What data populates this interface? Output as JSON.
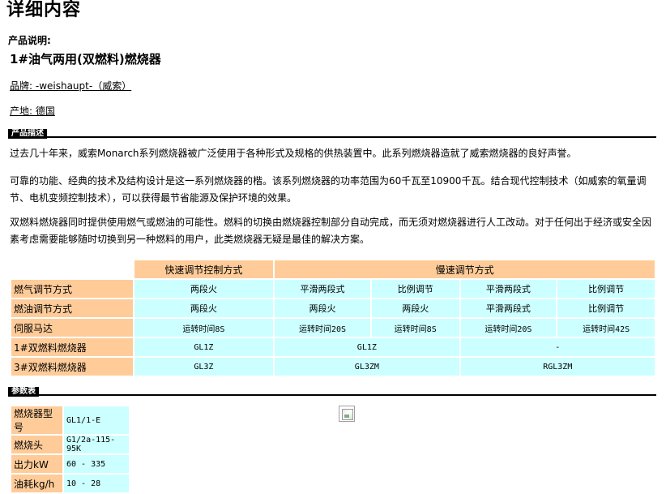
{
  "page": {
    "title": "详细内容",
    "desc_label": "产品说明:",
    "product_name": "1#油气两用(双燃料)燃烧器",
    "brand": "品牌: -weishaupt-（威索）",
    "origin": "产地: 德国"
  },
  "sections": {
    "intro_tag": "产品描述",
    "params_tag": "参数表"
  },
  "paragraphs": [
    "过去几十年来，威索Monarch系列燃烧器被广泛使用于各种形式及规格的供热装置中。此系列燃烧器造就了威索燃烧器的良好声誉。",
    "可靠的功能、经典的技术及结构设计是这一系列燃烧器的楷。该系列燃烧器的功率范围为60千瓦至10900千瓦。结合现代控制技术（如威索的氧量调节、电机变频控制技术），可以获得最节省能源及保护环境的效果。",
    "双燃料燃烧器同时提供使用燃气或燃油的可能性。燃料的切换由燃烧器控制部分自动完成，而无须对燃烧器进行人工改动。对于任何出于经济或安全因素考虑需要能够随时切换到另一种燃料的用户，此类燃烧器无疑是最佳的解决方案。"
  ],
  "compare_table": {
    "head_fast": "快速调节控制方式",
    "head_slow": "慢速调节方式",
    "rows": {
      "gas": {
        "label": "燃气调节方式",
        "cells": [
          "两段火",
          "平滑两段式",
          "比例调节",
          "平滑两段式",
          "比例调节"
        ]
      },
      "oil": {
        "label": "燃油调节方式",
        "cells": [
          "两段火",
          "两段火",
          "两段火",
          "平滑两段式",
          "比例调节"
        ]
      },
      "servo": {
        "label": "伺服马达",
        "cells": [
          "运转时间8S",
          "运转时间20S",
          "运转时间8S",
          "运转时间20S",
          "运转时间42S"
        ]
      },
      "burner1": {
        "label": "1#双燃料燃烧器",
        "cells": [
          "GL1Z",
          "GL1Z",
          "-"
        ]
      },
      "burner3": {
        "label": "3#双燃料燃烧器",
        "cells": [
          "GL3Z",
          "GL3ZM",
          "RGL3ZM"
        ]
      }
    }
  },
  "params_table": [
    {
      "label": "燃烧器型号",
      "value": "GL1/1-E"
    },
    {
      "label": "燃烧头",
      "value": "G1/2a-115-95K"
    },
    {
      "label": "出力kW",
      "value": "60 - 335"
    },
    {
      "label": "油耗kg/h",
      "value": "10 - 28"
    }
  ]
}
